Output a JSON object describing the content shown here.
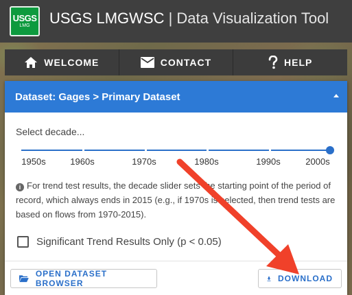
{
  "header": {
    "logo_text": "USGS",
    "logo_subtext": "LMG",
    "title_main": "USGS LMGWSC",
    "title_separator": " | ",
    "title_secondary": "Data Visualization Tool"
  },
  "nav": {
    "items": [
      {
        "label": "WELCOME",
        "icon": "home-icon"
      },
      {
        "label": "CONTACT",
        "icon": "mail-icon"
      },
      {
        "label": "HELP",
        "icon": "help-icon"
      }
    ]
  },
  "panel": {
    "title": "Dataset: Gages > Primary Dataset",
    "decade_prompt": "Select decade...",
    "slider": {
      "labels": [
        "1950s",
        "1960s",
        "1970s",
        "1980s",
        "1990s",
        "2000s"
      ],
      "selected": "2000s"
    },
    "info_text": "For trend test results, the decade slider sets the starting point of the period of record, which always ends in 2015 (e.g., if 1970s is selected, then trend tests are based on flows from 1970-2015).",
    "checkbox_label": "Significant Trend Results Only (p < 0.05)",
    "checkbox_checked": false,
    "buttons": {
      "open_browser": "OPEN DATASET BROWSER",
      "download": "DOWNLOAD"
    }
  },
  "colors": {
    "header_bg": "#3f3f3f",
    "panel_header_bg": "#2d7ad6",
    "accent": "#2a6fc9",
    "annotation_arrow": "#f0412a",
    "logo_green": "#0d9a3e"
  }
}
